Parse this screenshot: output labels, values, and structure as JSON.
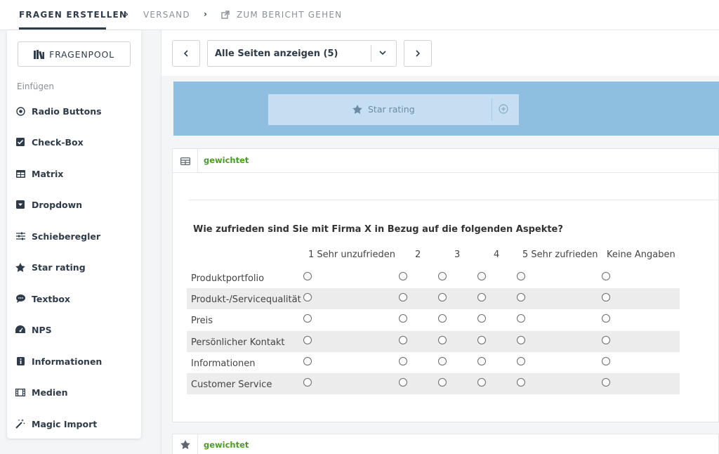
{
  "nav": {
    "steps": [
      "FRAGEN ERSTELLEN",
      "VERSAND",
      "ZUM BERICHT GEHEN"
    ],
    "active_index": 0
  },
  "sidebar": {
    "pool_button": "FRAGENPOOL",
    "section_label": "Einfügen",
    "items": [
      {
        "label": "Radio Buttons",
        "icon": "radio-icon"
      },
      {
        "label": "Check-Box",
        "icon": "checkbox-icon"
      },
      {
        "label": "Matrix",
        "icon": "table-icon"
      },
      {
        "label": "Dropdown",
        "icon": "dropdown-icon"
      },
      {
        "label": "Schieberegler",
        "icon": "sliders-icon"
      },
      {
        "label": "Star rating",
        "icon": "star-icon"
      },
      {
        "label": "Textbox",
        "icon": "comment-icon"
      },
      {
        "label": "NPS",
        "icon": "gauge-icon"
      },
      {
        "label": "Informationen",
        "icon": "info-icon"
      },
      {
        "label": "Medien",
        "icon": "film-icon"
      },
      {
        "label": "Magic Import",
        "icon": "magic-wand-icon"
      }
    ]
  },
  "toolbar": {
    "page_select_value": "Alle Seiten anzeigen (5)"
  },
  "drag_tile": {
    "label": "Star rating"
  },
  "matrix_card": {
    "tag": "gewichtet",
    "question": "Wie zufrieden sind Sie mit Firma X in Bezug auf die folgenden Aspekte?",
    "columns": [
      "1 Sehr unzufrieden",
      "2",
      "3",
      "4",
      "5 Sehr zufrieden",
      "Keine Angaben"
    ],
    "rows": [
      "Produktportfolio",
      "Produkt-/Servicequalität",
      "Preis",
      "Persönlicher Kontakt",
      "Informationen",
      "Customer Service"
    ]
  },
  "star_card": {
    "tag": "gewichtet"
  },
  "colors": {
    "dark": "#2f3b48",
    "green": "#4c9a2a",
    "dropzone": "#8fbfe0"
  }
}
